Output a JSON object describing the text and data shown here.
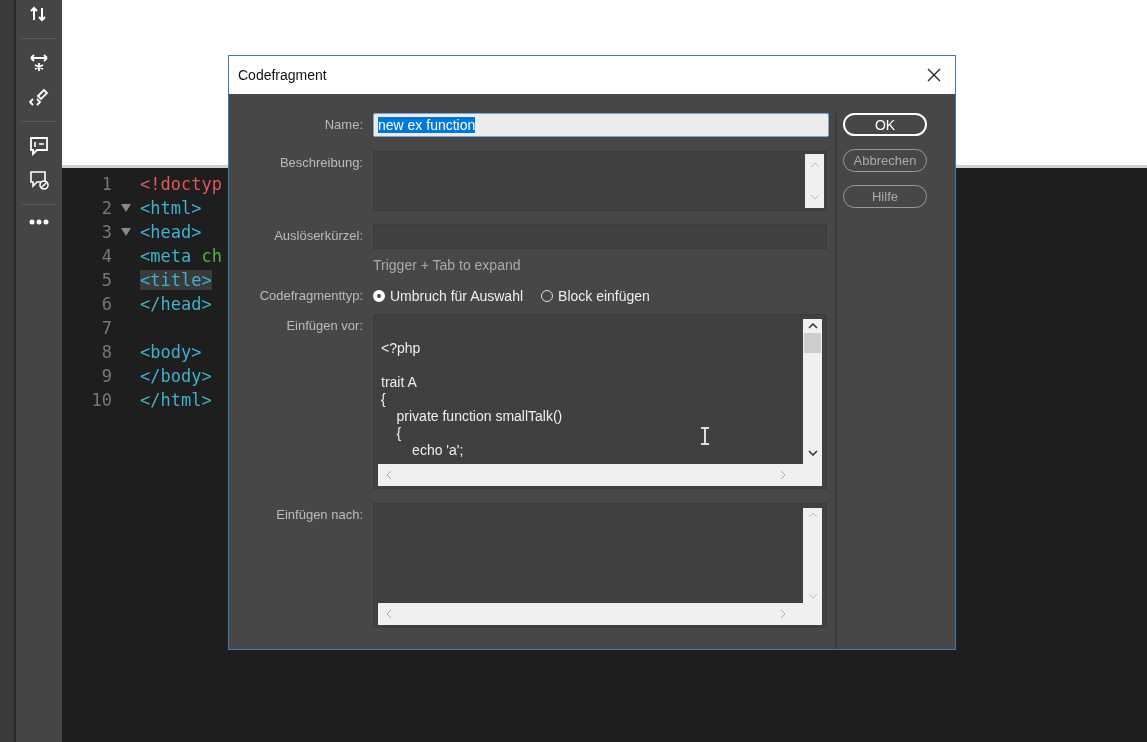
{
  "editor": {
    "lines": [
      {
        "number": "1",
        "foldable": false,
        "highlighted": false,
        "tokens": [
          {
            "kind": "doctype",
            "text": "<!doctyp"
          }
        ]
      },
      {
        "number": "2",
        "foldable": true,
        "highlighted": false,
        "tokens": [
          {
            "kind": "tag",
            "text": "<html>"
          }
        ]
      },
      {
        "number": "3",
        "foldable": true,
        "highlighted": false,
        "tokens": [
          {
            "kind": "tag",
            "text": "<head>"
          }
        ]
      },
      {
        "number": "4",
        "foldable": false,
        "highlighted": false,
        "tokens": [
          {
            "kind": "tag",
            "text": "<meta"
          },
          {
            "kind": "attr",
            "text": " ch"
          }
        ]
      },
      {
        "number": "5",
        "foldable": false,
        "highlighted": true,
        "tokens": [
          {
            "kind": "tag",
            "text": "<title>"
          }
        ]
      },
      {
        "number": "6",
        "foldable": false,
        "highlighted": false,
        "tokens": [
          {
            "kind": "tag",
            "text": "</head>"
          }
        ]
      },
      {
        "number": "7",
        "foldable": false
      },
      {
        "number": "8",
        "foldable": false,
        "highlighted": false,
        "tokens": [
          {
            "kind": "tag",
            "text": "<body>"
          }
        ]
      },
      {
        "number": "9",
        "foldable": false,
        "highlighted": false,
        "tokens": [
          {
            "kind": "tag",
            "text": "</body>"
          }
        ]
      },
      {
        "number": "10",
        "foldable": false,
        "highlighted": false,
        "tokens": [
          {
            "kind": "tag",
            "text": "</html>"
          }
        ]
      }
    ]
  },
  "dialog": {
    "title": "Codefragment",
    "name": {
      "label": "Name:",
      "value": "new ex function"
    },
    "description": {
      "label": "Beschreibung:"
    },
    "trigger": {
      "label": "Auslöserkürzel:",
      "hint": "Trigger + Tab to expand"
    },
    "type": {
      "label": "Codefragmenttyp:",
      "options": [
        {
          "label": "Umbruch für Auswahl",
          "selected": true
        },
        {
          "label": "Block einfügen",
          "selected": false
        }
      ]
    },
    "insert_before": {
      "label": "Einfügen vor:",
      "code": "<?php\n\ntrait A\n{\n    private function smallTalk()\n    {\n        echo 'a';"
    },
    "insert_after": {
      "label": "Einfügen nach:"
    },
    "buttons": [
      {
        "label": "OK",
        "default": true
      },
      {
        "label": "Abbrechen",
        "default": false
      },
      {
        "label": "Hilfe",
        "default": false
      }
    ]
  }
}
